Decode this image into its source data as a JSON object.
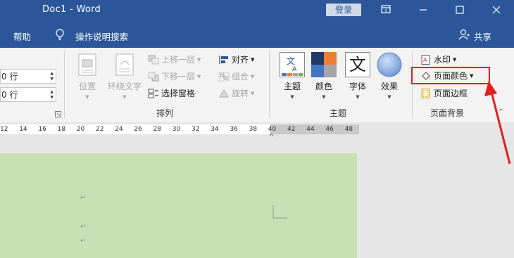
{
  "window": {
    "title": "Doc1  -  Word",
    "login_label": "登录"
  },
  "menubar": {
    "help_label": "帮助",
    "search_label": "操作说明搜索",
    "share_label": "共享"
  },
  "paragraph_spacing": {
    "before_value": "0 行",
    "after_value": "0 行"
  },
  "arrange": {
    "group_label": "排列",
    "position_label": "位置",
    "wrap_text_label": "环绕文字",
    "bring_forward_label": "上移一层",
    "send_backward_label": "下移一层",
    "selection_pane_label": "选择窗格",
    "align_label": "对齐",
    "group_objects_label": "组合",
    "rotate_label": "旋转"
  },
  "themes": {
    "group_label": "主题",
    "themes_label": "主题",
    "colors_label": "颜色",
    "fonts_label": "字体",
    "effects_label": "效果",
    "fonts_icon_char": "文"
  },
  "page_background": {
    "group_label": "页面背景",
    "watermark_label": "水印",
    "page_color_label": "页面颜色",
    "page_borders_label": "页面边框"
  },
  "ruler": {
    "ticks": [
      "12",
      "14",
      "16",
      "18",
      "20",
      "22",
      "24",
      "26",
      "28",
      "30",
      "32",
      "34",
      "36",
      "38",
      "40",
      "42",
      "44",
      "46",
      "48"
    ]
  },
  "document": {
    "paragraph_mark": "↵"
  },
  "colors": {
    "title_bar": "#2b579a",
    "ribbon": "#f3f3f3",
    "page_background": "#c7e0b4",
    "highlight": "#e02020"
  }
}
